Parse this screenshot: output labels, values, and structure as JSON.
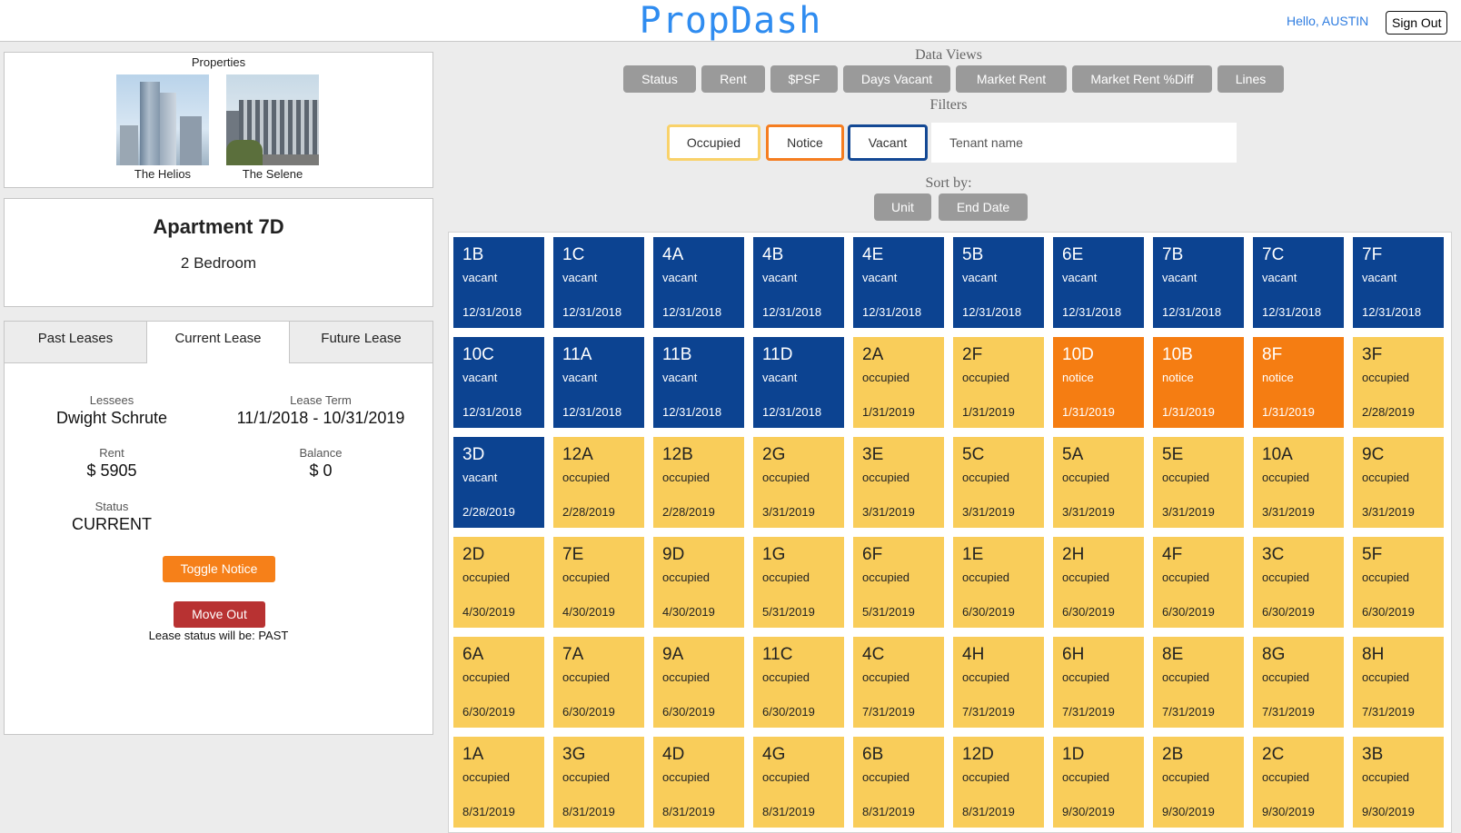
{
  "header": {
    "brand": "PropDash",
    "greeting": "Hello, AUSTIN",
    "sign_out": "Sign Out"
  },
  "properties": {
    "title": "Properties",
    "items": [
      {
        "name": "The Helios"
      },
      {
        "name": "The Selene"
      }
    ]
  },
  "apartment": {
    "title": "Apartment 7D",
    "subtitle": "2 Bedroom"
  },
  "lease": {
    "tabs": [
      "Past Leases",
      "Current Lease",
      "Future Lease"
    ],
    "active_tab": "Current Lease",
    "lessees_label": "Lessees",
    "lessees": "Dwight Schrute",
    "term_label": "Lease Term",
    "term": "11/1/2018 - 10/31/2019",
    "rent_label": "Rent",
    "rent": "$ 5905",
    "balance_label": "Balance",
    "balance": "$ 0",
    "status_label": "Status",
    "status": "CURRENT",
    "toggle_notice": "Toggle Notice",
    "move_out": "Move Out",
    "status_note": "Lease status will be: PAST"
  },
  "data_views": {
    "label": "Data Views",
    "buttons": [
      "Status",
      "Rent",
      "$PSF",
      "Days Vacant",
      "Market Rent",
      "Market Rent %Diff",
      "Lines"
    ]
  },
  "filters": {
    "label": "Filters",
    "occupied": "Occupied",
    "notice": "Notice",
    "vacant": "Vacant",
    "tenant_placeholder": "Tenant name"
  },
  "sort": {
    "label": "Sort by:",
    "buttons": [
      "Unit",
      "End Date"
    ]
  },
  "colors": {
    "vacant": "#0c4391",
    "occupied": "#f9cd5a",
    "notice": "#f57d12",
    "brand": "#2f8cf0"
  },
  "units": [
    {
      "unit": "1B",
      "status": "vacant",
      "date": "12/31/2018"
    },
    {
      "unit": "1C",
      "status": "vacant",
      "date": "12/31/2018"
    },
    {
      "unit": "4A",
      "status": "vacant",
      "date": "12/31/2018"
    },
    {
      "unit": "4B",
      "status": "vacant",
      "date": "12/31/2018"
    },
    {
      "unit": "4E",
      "status": "vacant",
      "date": "12/31/2018"
    },
    {
      "unit": "5B",
      "status": "vacant",
      "date": "12/31/2018"
    },
    {
      "unit": "6E",
      "status": "vacant",
      "date": "12/31/2018"
    },
    {
      "unit": "7B",
      "status": "vacant",
      "date": "12/31/2018"
    },
    {
      "unit": "7C",
      "status": "vacant",
      "date": "12/31/2018"
    },
    {
      "unit": "7F",
      "status": "vacant",
      "date": "12/31/2018"
    },
    {
      "unit": "10C",
      "status": "vacant",
      "date": "12/31/2018"
    },
    {
      "unit": "11A",
      "status": "vacant",
      "date": "12/31/2018"
    },
    {
      "unit": "11B",
      "status": "vacant",
      "date": "12/31/2018"
    },
    {
      "unit": "11D",
      "status": "vacant",
      "date": "12/31/2018"
    },
    {
      "unit": "2A",
      "status": "occupied",
      "date": "1/31/2019"
    },
    {
      "unit": "2F",
      "status": "occupied",
      "date": "1/31/2019"
    },
    {
      "unit": "10D",
      "status": "notice",
      "date": "1/31/2019"
    },
    {
      "unit": "10B",
      "status": "notice",
      "date": "1/31/2019"
    },
    {
      "unit": "8F",
      "status": "notice",
      "date": "1/31/2019"
    },
    {
      "unit": "3F",
      "status": "occupied",
      "date": "2/28/2019"
    },
    {
      "unit": "3D",
      "status": "vacant",
      "date": "2/28/2019"
    },
    {
      "unit": "12A",
      "status": "occupied",
      "date": "2/28/2019"
    },
    {
      "unit": "12B",
      "status": "occupied",
      "date": "2/28/2019"
    },
    {
      "unit": "2G",
      "status": "occupied",
      "date": "3/31/2019"
    },
    {
      "unit": "3E",
      "status": "occupied",
      "date": "3/31/2019"
    },
    {
      "unit": "5C",
      "status": "occupied",
      "date": "3/31/2019"
    },
    {
      "unit": "5A",
      "status": "occupied",
      "date": "3/31/2019"
    },
    {
      "unit": "5E",
      "status": "occupied",
      "date": "3/31/2019"
    },
    {
      "unit": "10A",
      "status": "occupied",
      "date": "3/31/2019"
    },
    {
      "unit": "9C",
      "status": "occupied",
      "date": "3/31/2019"
    },
    {
      "unit": "2D",
      "status": "occupied",
      "date": "4/30/2019"
    },
    {
      "unit": "7E",
      "status": "occupied",
      "date": "4/30/2019"
    },
    {
      "unit": "9D",
      "status": "occupied",
      "date": "4/30/2019"
    },
    {
      "unit": "1G",
      "status": "occupied",
      "date": "5/31/2019"
    },
    {
      "unit": "6F",
      "status": "occupied",
      "date": "5/31/2019"
    },
    {
      "unit": "1E",
      "status": "occupied",
      "date": "6/30/2019"
    },
    {
      "unit": "2H",
      "status": "occupied",
      "date": "6/30/2019"
    },
    {
      "unit": "4F",
      "status": "occupied",
      "date": "6/30/2019"
    },
    {
      "unit": "3C",
      "status": "occupied",
      "date": "6/30/2019"
    },
    {
      "unit": "5F",
      "status": "occupied",
      "date": "6/30/2019"
    },
    {
      "unit": "6A",
      "status": "occupied",
      "date": "6/30/2019"
    },
    {
      "unit": "7A",
      "status": "occupied",
      "date": "6/30/2019"
    },
    {
      "unit": "9A",
      "status": "occupied",
      "date": "6/30/2019"
    },
    {
      "unit": "11C",
      "status": "occupied",
      "date": "6/30/2019"
    },
    {
      "unit": "4C",
      "status": "occupied",
      "date": "7/31/2019"
    },
    {
      "unit": "4H",
      "status": "occupied",
      "date": "7/31/2019"
    },
    {
      "unit": "6H",
      "status": "occupied",
      "date": "7/31/2019"
    },
    {
      "unit": "8E",
      "status": "occupied",
      "date": "7/31/2019"
    },
    {
      "unit": "8G",
      "status": "occupied",
      "date": "7/31/2019"
    },
    {
      "unit": "8H",
      "status": "occupied",
      "date": "7/31/2019"
    },
    {
      "unit": "1A",
      "status": "occupied",
      "date": "8/31/2019"
    },
    {
      "unit": "3G",
      "status": "occupied",
      "date": "8/31/2019"
    },
    {
      "unit": "4D",
      "status": "occupied",
      "date": "8/31/2019"
    },
    {
      "unit": "4G",
      "status": "occupied",
      "date": "8/31/2019"
    },
    {
      "unit": "6B",
      "status": "occupied",
      "date": "8/31/2019"
    },
    {
      "unit": "12D",
      "status": "occupied",
      "date": "8/31/2019"
    },
    {
      "unit": "1D",
      "status": "occupied",
      "date": "9/30/2019"
    },
    {
      "unit": "2B",
      "status": "occupied",
      "date": "9/30/2019"
    },
    {
      "unit": "2C",
      "status": "occupied",
      "date": "9/30/2019"
    },
    {
      "unit": "3B",
      "status": "occupied",
      "date": "9/30/2019"
    }
  ]
}
